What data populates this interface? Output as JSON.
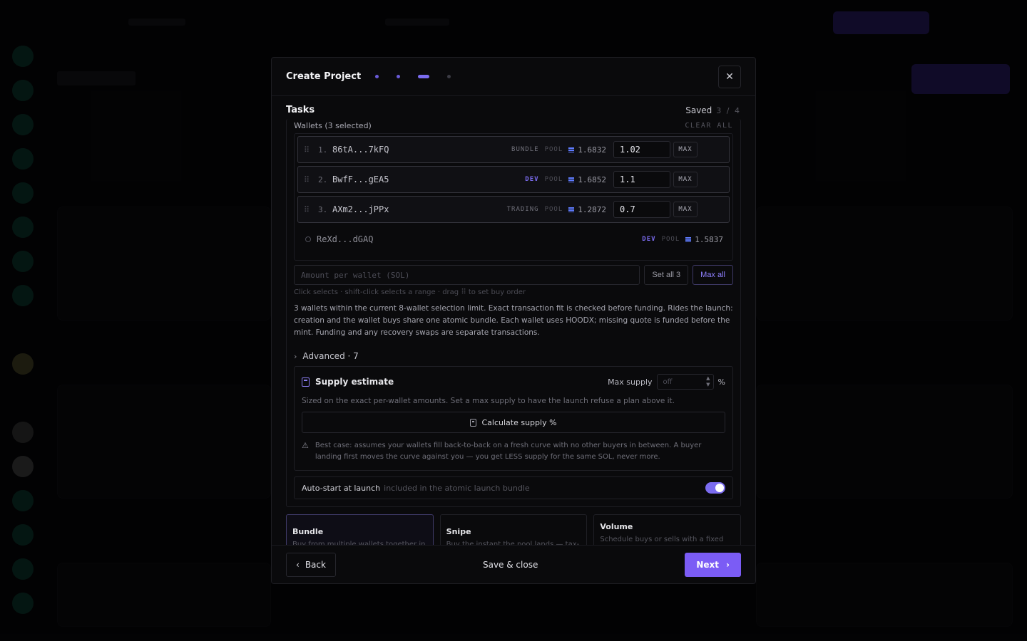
{
  "modal": {
    "title": "Create Project",
    "close_icon": "close-icon",
    "steps": [
      "done",
      "done",
      "active",
      "todo"
    ]
  },
  "section": {
    "title": "Tasks",
    "saved_label": "Saved",
    "step_counter": "3 / 4"
  },
  "wallets": {
    "header": "Wallets (3 selected)",
    "clear_all": "CLEAR ALL",
    "selected": [
      {
        "index": "1.",
        "address": "86tA...7kFQ",
        "role": "BUNDLE",
        "pool": "POOL",
        "balance": "1.6832",
        "amount": "1.02",
        "max": "MAX"
      },
      {
        "index": "2.",
        "address": "BwfF...gEA5",
        "role": "DEV",
        "pool": "POOL",
        "balance": "1.6852",
        "amount": "1.1",
        "max": "MAX"
      },
      {
        "index": "3.",
        "address": "AXm2...jPPx",
        "role": "TRADING",
        "pool": "POOL",
        "balance": "1.2872",
        "amount": "0.7",
        "max": "MAX"
      }
    ],
    "unselected": [
      {
        "address": "ReXd...dGAQ",
        "role": "DEV",
        "pool": "POOL",
        "balance": "1.5837"
      }
    ],
    "amount_placeholder": "Amount per wallet (SOL)",
    "set_all_label": "Set all 3",
    "max_all_label": "Max all",
    "hint": "Click selects · shift-click selects a range · drag ⠿ to set buy order",
    "description": "3 wallets within the current 8-wallet selection limit. Exact transaction fit is checked before funding. Rides the launch: creation and the wallet buys share one atomic bundle. Each wallet uses HOODX; missing quote is funded before the mint. Funding and any recovery swaps are separate transactions."
  },
  "advanced": {
    "label": "Advanced · 7"
  },
  "supply": {
    "title": "Supply estimate",
    "max_supply_label": "Max supply",
    "max_supply_placeholder": "off",
    "percent": "%",
    "description": "Sized on the exact per-wallet amounts. Set a max supply to have the launch refuse a plan above it.",
    "calc_button": "Calculate supply %",
    "warning": "Best case: assumes your wallets fill back-to-back on a fresh curve with no other buyers in between. A buyer landing first moves the curve against you — you get LESS supply for the same SOL, never more."
  },
  "auto_start": {
    "label": "Auto-start at launch",
    "sublabel": "included in the atomic launch bundle",
    "enabled": true
  },
  "task_types": [
    {
      "title": "Bundle",
      "desc": "Buy from multiple wallets together in"
    },
    {
      "title": "Snipe",
      "desc": "Buy the instant the pool lands — tax-"
    },
    {
      "title": "Volume",
      "desc": "Schedule buys or sells with a fixed interval, wallet rotation and a spending"
    }
  ],
  "footer": {
    "back_label": "Back",
    "save_close_label": "Save & close",
    "next_label": "Next"
  },
  "colors": {
    "accent": "#7b5cf5",
    "dev_tag": "#7b6cf0"
  }
}
